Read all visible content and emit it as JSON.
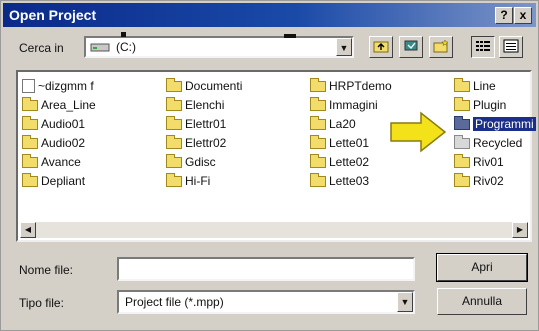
{
  "window": {
    "title": "Open Project",
    "help_glyph": "?",
    "close_glyph": "x"
  },
  "lookin": {
    "label": "Cerca in",
    "value": "(C:)",
    "icon": "drive-icon"
  },
  "toolbar": {
    "up_icon": "up-folder-icon",
    "desktop_icon": "desktop-icon",
    "new_folder_icon": "new-folder-icon",
    "list_icon": "list-view-icon",
    "details_icon": "details-view-icon"
  },
  "files": {
    "columns": [
      [
        {
          "name": "~dizgmm f",
          "icon": "document-icon"
        },
        {
          "name": "Area_Line",
          "icon": "folder-icon"
        },
        {
          "name": "Audio01",
          "icon": "folder-icon"
        },
        {
          "name": "Audio02",
          "icon": "folder-icon"
        },
        {
          "name": "Avance",
          "icon": "folder-icon"
        },
        {
          "name": "Depliant",
          "icon": "folder-icon"
        }
      ],
      [
        {
          "name": "Documenti",
          "icon": "folder-icon"
        },
        {
          "name": "Elenchi",
          "icon": "folder-icon"
        },
        {
          "name": "Elettr01",
          "icon": "folder-icon"
        },
        {
          "name": "Elettr02",
          "icon": "folder-icon"
        },
        {
          "name": "Gdisc",
          "icon": "folder-icon"
        },
        {
          "name": "Hi-Fi",
          "icon": "folder-icon"
        }
      ],
      [
        {
          "name": "HRPTdemo",
          "icon": "folder-icon"
        },
        {
          "name": "Immagini",
          "icon": "folder-icon"
        },
        {
          "name": "La20",
          "icon": "folder-icon"
        },
        {
          "name": "Lette01",
          "icon": "folder-icon"
        },
        {
          "name": "Lette02",
          "icon": "folder-icon"
        },
        {
          "name": "Lette03",
          "icon": "folder-icon"
        }
      ],
      [
        {
          "name": "Line",
          "icon": "folder-icon"
        },
        {
          "name": "Plugin",
          "icon": "folder-icon"
        },
        {
          "name": "Programmi",
          "icon": "folder-icon",
          "selected": true
        },
        {
          "name": "Recycled",
          "icon": "recycle-folder-icon"
        },
        {
          "name": "Riv01",
          "icon": "folder-icon"
        },
        {
          "name": "Riv02",
          "icon": "folder-icon"
        }
      ]
    ]
  },
  "filename": {
    "label": "Nome file:",
    "value": ""
  },
  "filetype": {
    "label": "Tipo file:",
    "value": "Project file (*.mpp)"
  },
  "buttons": {
    "open": "Apri",
    "cancel": "Annulla"
  },
  "colors": {
    "title_bar": "#0a2a8a",
    "selection": "#1a2e8a",
    "callout_arrow": "#f3e11a"
  }
}
